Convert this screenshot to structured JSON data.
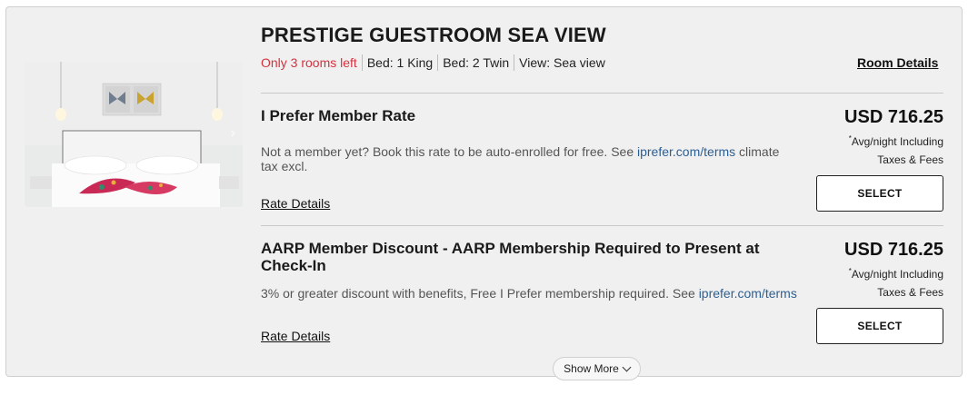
{
  "room": {
    "title": "PRESTIGE GUESTROOM SEA VIEW",
    "availability": "Only 3 rooms left",
    "attributes": [
      "Bed: 1 King",
      "Bed: 2 Twin",
      "View: Sea view"
    ],
    "details_link": "Room Details",
    "image_icon": "bedroom-photo",
    "colors": {
      "availability": "#d4323f",
      "link": "#2c5f93"
    }
  },
  "rates": [
    {
      "name": "I Prefer Member Rate",
      "description": "Not a member yet? Book this rate to be auto-enrolled for free. See ",
      "link_text": "iprefer.com/terms",
      "description_suffix": " climate tax excl.",
      "details_link": "Rate Details",
      "price": "USD 716.25",
      "note_mark": "*",
      "note_line1": "Avg/night Including",
      "note_line2": "Taxes & Fees",
      "select_label": "SELECT"
    },
    {
      "name": "AARP Member Discount - AARP Membership Required to Present at Check-In",
      "description": "3% or greater discount with benefits, Free I Prefer membership required. See ",
      "link_text": "iprefer.com/terms",
      "description_suffix": "",
      "details_link": "Rate Details",
      "price": "USD 716.25",
      "note_mark": "*",
      "note_line1": "Avg/night Including",
      "note_line2": "Taxes & Fees",
      "select_label": "SELECT"
    }
  ],
  "show_more_label": "Show More"
}
